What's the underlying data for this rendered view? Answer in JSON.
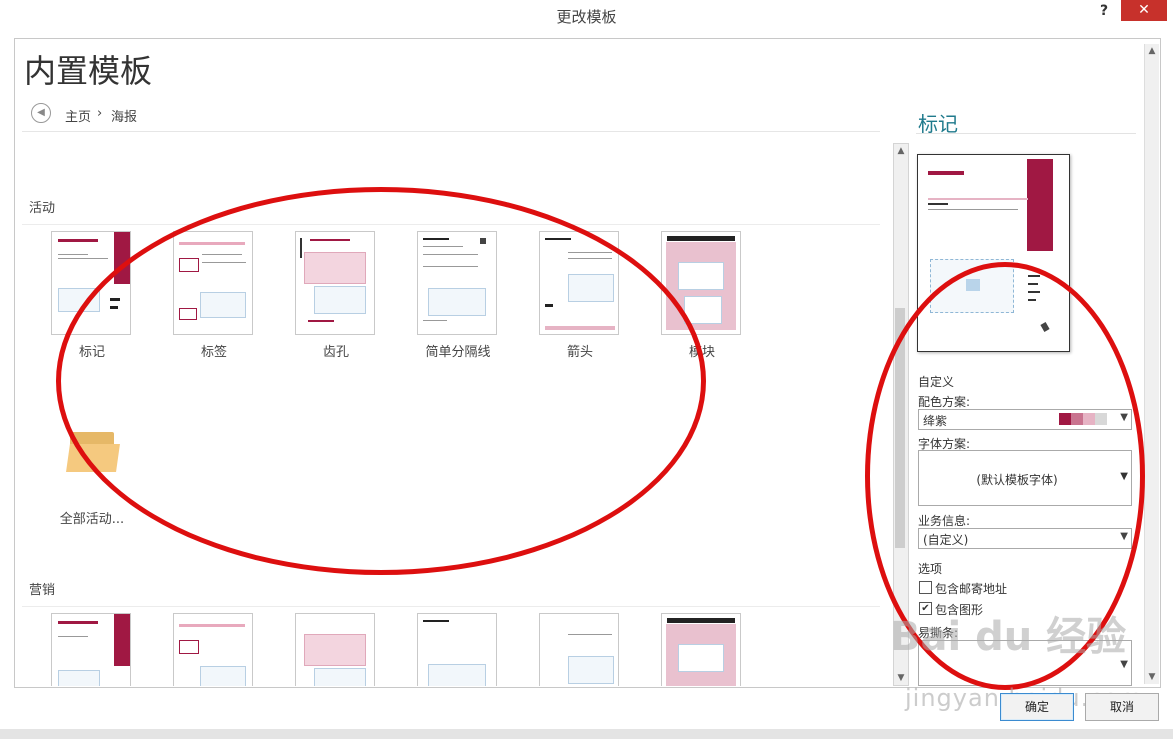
{
  "window": {
    "title": "更改模板",
    "help": "?",
    "close": "✕"
  },
  "heading": "内置模板",
  "breadcrumb": {
    "home": "主页",
    "separator": "›",
    "current": "海报"
  },
  "sections": [
    {
      "label": "活动",
      "items": [
        "标记",
        "标签",
        "齿孔",
        "简单分隔线",
        "箭头",
        "模块"
      ],
      "extra": "全部活动..."
    },
    {
      "label": "营销"
    }
  ],
  "right_panel": {
    "title": "标记",
    "customize": "自定义",
    "color_scheme_label": "配色方案:",
    "color_scheme_value": "绛紫",
    "color_swatches": [
      "#a01843",
      "#c9738f",
      "#e6b3c4",
      "#d8d8d8"
    ],
    "font_scheme_label": "字体方案:",
    "font_scheme_value": "(默认模板字体)",
    "business_info_label": "业务信息:",
    "business_info_value": "(自定义)",
    "options_label": "选项",
    "option_mailing": "包含邮寄地址",
    "option_graphics": "包含图形",
    "option_graphics_checked": true,
    "tearoff_label": "易撕条:"
  },
  "buttons": {
    "ok": "确定",
    "cancel": "取消"
  },
  "accent_color": "#1f7a8c",
  "watermark": {
    "brand": "Bai du 经验",
    "url": "jingyan.baidu.com"
  }
}
